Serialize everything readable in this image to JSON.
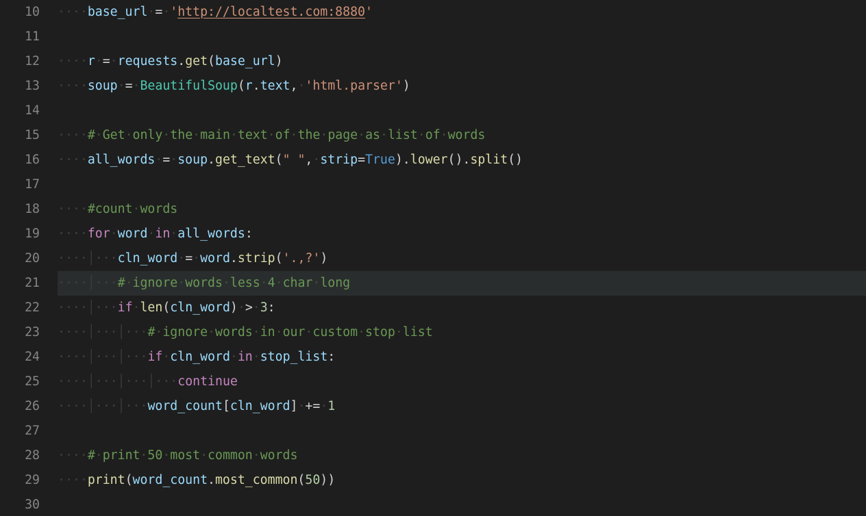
{
  "editor": {
    "theme": "dark-plus",
    "language": "python",
    "showWhitespace": true,
    "highlightedLineIndex": 11
  },
  "colors": {
    "background": "#1e1e1e",
    "gutterFg": "#858585",
    "whitespace": "#404040",
    "keyword": "#c586c0",
    "function": "#dcdcaa",
    "variable": "#9cdcfe",
    "class": "#4ec9b0",
    "string": "#ce9178",
    "number": "#b5cea8",
    "comment": "#6a9955",
    "bool": "#569cd6",
    "lineHighlight": "#2a2d2e"
  },
  "lines": [
    {
      "n": 10,
      "i": 1,
      "tokens": [
        [
          "var",
          "base_url"
        ],
        [
          "ws",
          " "
        ],
        [
          "op",
          "="
        ],
        [
          "ws",
          " "
        ],
        [
          "str",
          "'"
        ],
        [
          "str url",
          "http://localtest.com:8880"
        ],
        [
          "str",
          "'"
        ]
      ]
    },
    {
      "n": 11,
      "i": 0,
      "tokens": []
    },
    {
      "n": 12,
      "i": 1,
      "tokens": [
        [
          "var",
          "r"
        ],
        [
          "ws",
          " "
        ],
        [
          "op",
          "="
        ],
        [
          "ws",
          " "
        ],
        [
          "var",
          "requests"
        ],
        [
          "punc",
          "."
        ],
        [
          "fn",
          "get"
        ],
        [
          "punc",
          "("
        ],
        [
          "var",
          "base_url"
        ],
        [
          "punc",
          ")"
        ]
      ]
    },
    {
      "n": 13,
      "i": 1,
      "tokens": [
        [
          "var",
          "soup"
        ],
        [
          "ws",
          " "
        ],
        [
          "op",
          "="
        ],
        [
          "ws",
          " "
        ],
        [
          "cls",
          "BeautifulSoup"
        ],
        [
          "punc",
          "("
        ],
        [
          "var",
          "r"
        ],
        [
          "punc",
          "."
        ],
        [
          "var",
          "text"
        ],
        [
          "punc",
          ","
        ],
        [
          "ws",
          " "
        ],
        [
          "str",
          "'html.parser'"
        ],
        [
          "punc",
          ")"
        ]
      ]
    },
    {
      "n": 14,
      "i": 0,
      "tokens": []
    },
    {
      "n": 15,
      "i": 1,
      "tokens": [
        [
          "cmt",
          "# Get only the main text of the page as list of words"
        ]
      ],
      "wsComment": true
    },
    {
      "n": 16,
      "i": 1,
      "tokens": [
        [
          "var",
          "all_words"
        ],
        [
          "ws",
          " "
        ],
        [
          "op",
          "="
        ],
        [
          "ws",
          " "
        ],
        [
          "var",
          "soup"
        ],
        [
          "punc",
          "."
        ],
        [
          "fn",
          "get_text"
        ],
        [
          "punc",
          "("
        ],
        [
          "str",
          "\" \""
        ],
        [
          "punc",
          ","
        ],
        [
          "ws",
          " "
        ],
        [
          "var",
          "strip"
        ],
        [
          "op",
          "="
        ],
        [
          "bool",
          "True"
        ],
        [
          "punc",
          ")"
        ],
        [
          "punc",
          "."
        ],
        [
          "fn",
          "lower"
        ],
        [
          "punc",
          "()"
        ],
        [
          "punc",
          "."
        ],
        [
          "fn",
          "split"
        ],
        [
          "punc",
          "()"
        ]
      ]
    },
    {
      "n": 17,
      "i": 0,
      "tokens": []
    },
    {
      "n": 18,
      "i": 1,
      "tokens": [
        [
          "cmt",
          "#count words"
        ]
      ],
      "wsComment": true
    },
    {
      "n": 19,
      "i": 1,
      "tokens": [
        [
          "kw",
          "for"
        ],
        [
          "ws",
          " "
        ],
        [
          "var",
          "word"
        ],
        [
          "ws",
          " "
        ],
        [
          "kw",
          "in"
        ],
        [
          "ws",
          " "
        ],
        [
          "var",
          "all_words"
        ],
        [
          "punc",
          ":"
        ]
      ]
    },
    {
      "n": 20,
      "i": 2,
      "guides": [
        1
      ],
      "tokens": [
        [
          "var",
          "cln_word"
        ],
        [
          "ws",
          " "
        ],
        [
          "op",
          "="
        ],
        [
          "ws",
          " "
        ],
        [
          "var",
          "word"
        ],
        [
          "punc",
          "."
        ],
        [
          "fn",
          "strip"
        ],
        [
          "punc",
          "("
        ],
        [
          "str",
          "'.,?'"
        ],
        [
          "punc",
          ")"
        ]
      ]
    },
    {
      "n": 21,
      "i": 2,
      "guides": [
        1
      ],
      "tokens": [
        [
          "cmt",
          "# ignore words less 4 char long"
        ]
      ],
      "wsComment": true,
      "highlight": true
    },
    {
      "n": 22,
      "i": 2,
      "guides": [
        1
      ],
      "tokens": [
        [
          "kw",
          "if"
        ],
        [
          "ws",
          " "
        ],
        [
          "fn",
          "len"
        ],
        [
          "punc",
          "("
        ],
        [
          "var",
          "cln_word"
        ],
        [
          "punc",
          ")"
        ],
        [
          "ws",
          " "
        ],
        [
          "op",
          ">"
        ],
        [
          "ws",
          " "
        ],
        [
          "num",
          "3"
        ],
        [
          "punc",
          ":"
        ]
      ]
    },
    {
      "n": 23,
      "i": 3,
      "guides": [
        1,
        2
      ],
      "tokens": [
        [
          "cmt",
          "# ignore words in our custom stop list"
        ]
      ],
      "wsComment": true
    },
    {
      "n": 24,
      "i": 3,
      "guides": [
        1,
        2
      ],
      "tokens": [
        [
          "kw",
          "if"
        ],
        [
          "ws",
          " "
        ],
        [
          "var",
          "cln_word"
        ],
        [
          "ws",
          " "
        ],
        [
          "kw",
          "in"
        ],
        [
          "ws",
          " "
        ],
        [
          "var",
          "stop_list"
        ],
        [
          "punc",
          ":"
        ]
      ]
    },
    {
      "n": 25,
      "i": 4,
      "guides": [
        1,
        2,
        3
      ],
      "tokens": [
        [
          "kw",
          "continue"
        ]
      ]
    },
    {
      "n": 26,
      "i": 3,
      "guides": [
        1,
        2
      ],
      "tokens": [
        [
          "var",
          "word_count"
        ],
        [
          "punc",
          "["
        ],
        [
          "var",
          "cln_word"
        ],
        [
          "punc",
          "]"
        ],
        [
          "ws",
          " "
        ],
        [
          "op",
          "+="
        ],
        [
          "ws",
          " "
        ],
        [
          "num",
          "1"
        ]
      ]
    },
    {
      "n": 27,
      "i": 0,
      "tokens": []
    },
    {
      "n": 28,
      "i": 1,
      "tokens": [
        [
          "cmt",
          "# print 50 most common words"
        ]
      ],
      "wsComment": true
    },
    {
      "n": 29,
      "i": 1,
      "tokens": [
        [
          "fn",
          "print"
        ],
        [
          "punc",
          "("
        ],
        [
          "var",
          "word_count"
        ],
        [
          "punc",
          "."
        ],
        [
          "fn",
          "most_common"
        ],
        [
          "punc",
          "("
        ],
        [
          "num",
          "50"
        ],
        [
          "punc",
          "))"
        ]
      ]
    },
    {
      "n": 30,
      "i": 0,
      "tokens": []
    }
  ]
}
